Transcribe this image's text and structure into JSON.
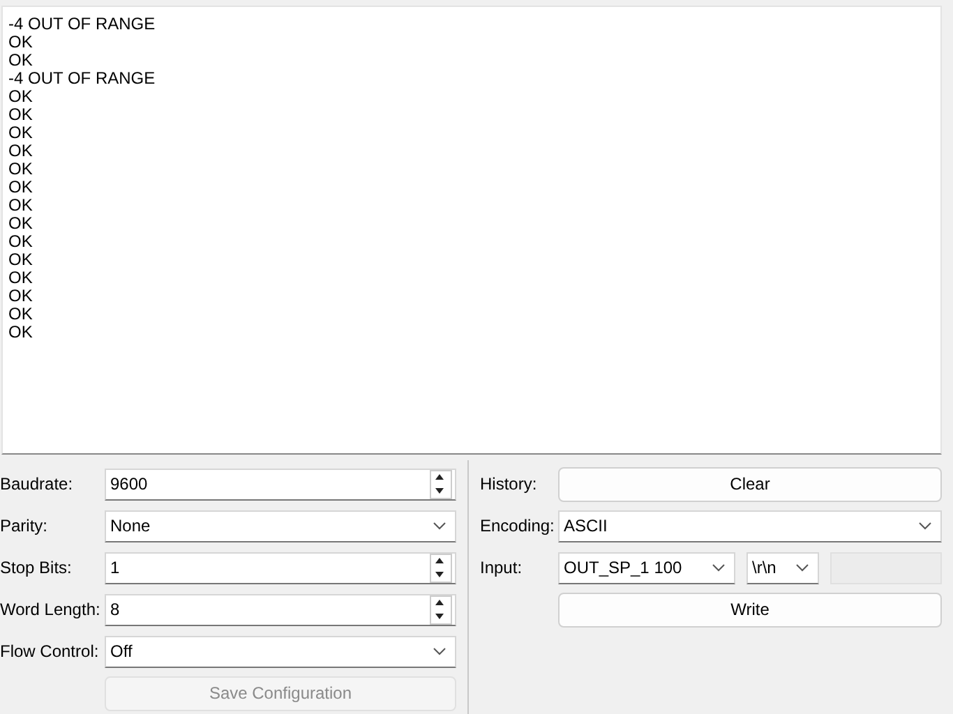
{
  "output_lines": [
    "-4 OUT OF RANGE",
    "OK",
    "OK",
    "-4 OUT OF RANGE",
    "OK",
    "OK",
    "OK",
    "OK",
    "OK",
    "OK",
    "OK",
    "OK",
    "OK",
    "OK",
    "OK",
    "OK",
    "OK",
    "OK"
  ],
  "settings": [
    {
      "label": "Baudrate:",
      "kind": "spin",
      "value": "9600"
    },
    {
      "label": "Parity:",
      "kind": "combo",
      "value": "None"
    },
    {
      "label": "Stop Bits:",
      "kind": "spin",
      "value": "1"
    },
    {
      "label": "Word Length:",
      "kind": "spin",
      "value": "8"
    },
    {
      "label": "Flow Control:",
      "kind": "combo",
      "value": "Off"
    }
  ],
  "save_button": {
    "label": "Save Configuration",
    "disabled": true
  },
  "history": {
    "label": "History:",
    "button": "Clear"
  },
  "encoding": {
    "label": "Encoding:",
    "value": "ASCII"
  },
  "input": {
    "label": "Input:",
    "value": "OUT_SP_1 100",
    "line_ending": "\\r\\n",
    "extra_disabled": true
  },
  "write_button": "Write"
}
